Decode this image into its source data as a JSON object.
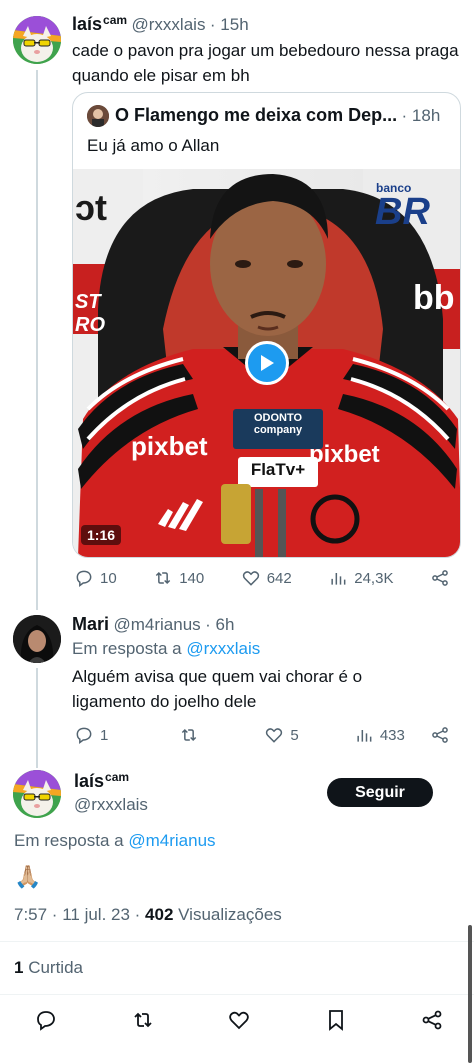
{
  "tweet1": {
    "name": "laís",
    "name_sup": "cam",
    "handle": "@rxxxlais",
    "time": "· 15h",
    "text": "cade o pavon pra jogar um bebedouro nessa praga quando ele pisar em bh",
    "quote": {
      "title": "O Flamengo me deixa com Dep...",
      "time": "· 18h",
      "text": "Eu já amo o Allan",
      "media": {
        "duration": "1:16",
        "sponsor_left": "ɔt",
        "sponsor_banco": "banco",
        "sponsor_br": "BR",
        "sponsor_st": "ST",
        "sponsor_ro": "RO",
        "sponsor_bb": "bb",
        "sponsor_pixbet_left": "pixbet",
        "sponsor_pixbet_right": "pixbet",
        "mic_odonto": "ODONTO",
        "mic_company": "company",
        "mic_flatv": "FlaTv+",
        "play_icon": "play-icon"
      }
    },
    "stats": {
      "replies": "10",
      "retweets": "140",
      "likes": "642",
      "views": "24,3K"
    }
  },
  "tweet2": {
    "name": "Mari",
    "handle": "@m4rianus",
    "time": "· 6h",
    "reply_prefix": "Em resposta a",
    "reply_to": "@rxxxlais",
    "text": "Alguém avisa que quem vai chorar é o ligamento do joelho dele",
    "stats": {
      "replies": "1",
      "retweets": "",
      "likes": "5",
      "views": "433"
    }
  },
  "main": {
    "name": "laís",
    "name_sup": "cam",
    "handle": "@rxxxlais",
    "follow_label": "Seguir",
    "reply_prefix": "Em resposta a",
    "reply_to": "@m4rianus",
    "text": "🙏🏼",
    "timestamp": "7:57 · 11 jul. 23 · ",
    "views_count": "402",
    "views_label": " Visualizações",
    "likes_count": "1",
    "likes_label": " Curtida"
  },
  "colors": {
    "accent": "#1d9bf0",
    "text": "#0f1419",
    "muted": "#536471",
    "flamengo_red": "#d1201f"
  }
}
